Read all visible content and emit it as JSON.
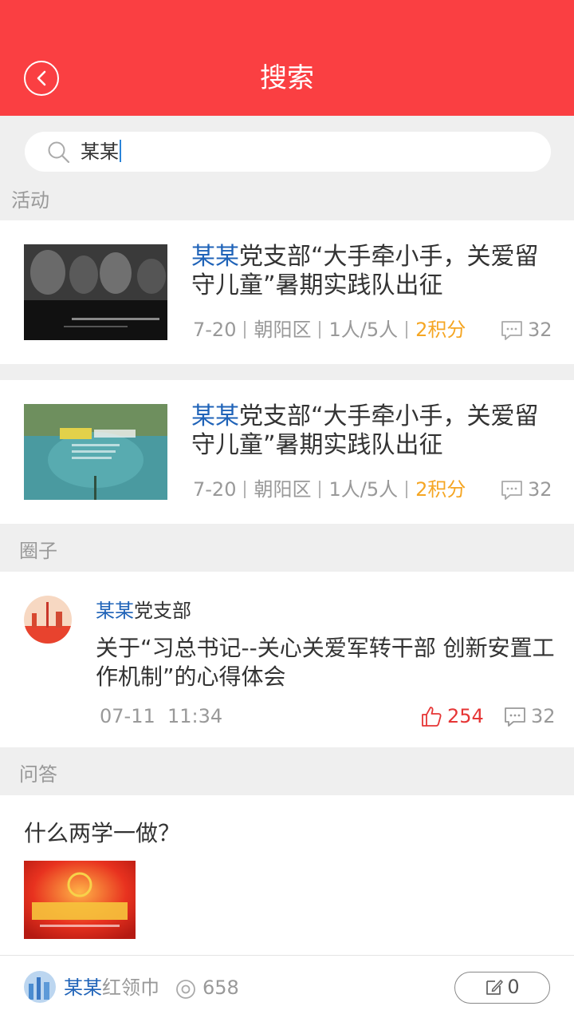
{
  "header": {
    "title": "搜索",
    "back_icon": "back-arrow-icon",
    "bg_color": "#fa3f42"
  },
  "search": {
    "value": "某某",
    "icon": "search-icon"
  },
  "sections": {
    "activity": "活动",
    "circle": "圈子",
    "qa": "问答"
  },
  "activities": [
    {
      "keyword": "某某",
      "title_rest": "党支部“大手牵小手，关爱留守儿童”暑期实践队出征",
      "date": "7-20",
      "district": "朝阳区",
      "people": "1人/5人",
      "points": "2积分",
      "comments": "32"
    },
    {
      "keyword": "某某",
      "title_rest": "党支部“大手牵小手，关爱留守儿童”暑期实践队出征",
      "date": "7-20",
      "district": "朝阳区",
      "people": "1人/5人",
      "points": "2积分",
      "comments": "32"
    }
  ],
  "circle_post": {
    "author_keyword": "某某",
    "author_rest": "党支部",
    "title": "关于“习总书记--关心关爱军转干部 创新安置工作机制”的心得体会",
    "date": "07-11",
    "time": "11:34",
    "likes": "254",
    "comments": "32"
  },
  "qa_post": {
    "question": "什么两学一做？",
    "user_keyword": "某某",
    "user_rest": "红领巾",
    "views": "658",
    "answers": "0"
  },
  "colors": {
    "highlight": "#1f63b8",
    "points": "#f5a623",
    "like": "#e63535"
  }
}
